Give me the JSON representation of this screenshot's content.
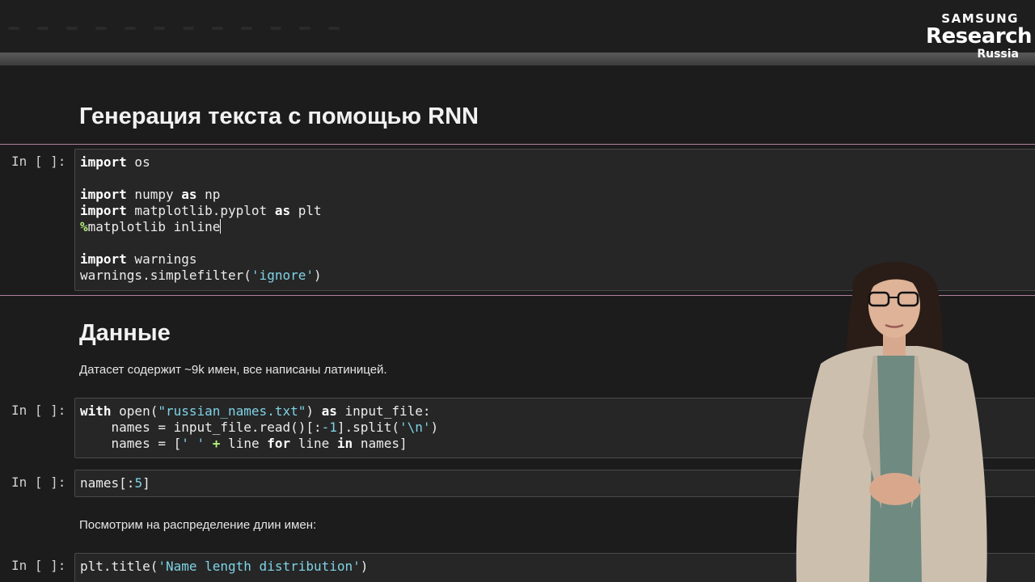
{
  "logo": {
    "line1": "SAMSUNG",
    "line2": "Research",
    "line3": "Russia"
  },
  "notebook": {
    "title": "Генерация текста с помощью RNN",
    "section_data_heading": "Данные",
    "dataset_description": "Датасет содержит ~9k имен, все написаны латиницей.",
    "distribution_text": "Посмотрим на распределение длин имен:",
    "prompt_label": "In [ ]:",
    "cells": {
      "imports": {
        "l1": {
          "kw": "import",
          "rest": " os"
        },
        "l2": {
          "kw": "import",
          "a": " numpy ",
          "kw2": "as",
          "b": " np"
        },
        "l3": {
          "kw": "import",
          "a": " matplotlib.pyplot ",
          "kw2": "as",
          "b": " plt"
        },
        "l4": {
          "op": "%",
          "rest": "matplotlib inline"
        },
        "l5": {
          "kw": "import",
          "rest": " warnings"
        },
        "l6": {
          "a": "warnings.simplefilter(",
          "str": "'ignore'",
          "b": ")"
        }
      },
      "read": {
        "l1": {
          "kw": "with",
          "a": " open(",
          "str": "\"russian_names.txt\"",
          "b": ") ",
          "kw2": "as",
          "c": " input_file:"
        },
        "l2": {
          "a": "    names = input_file.read()[:",
          "num": "-1",
          "b": "].split(",
          "str": "'\\n'",
          "c": ")"
        },
        "l3": {
          "a": "    names = [",
          "str": "' '",
          "b": " ",
          "op": "+",
          "c": " line ",
          "kw": "for",
          "d": " line ",
          "kw2": "in",
          "e": " names]"
        }
      },
      "head": {
        "a": "names[:",
        "num": "5",
        "b": "]"
      },
      "plot": {
        "a": "plt.title(",
        "str": "'Name length distribution'",
        "b": ")"
      }
    }
  },
  "colors": {
    "background": "#1c1c1c",
    "cell_separator": "#b07fa0",
    "string": "#7fd3e6",
    "operator": "#b6f07a"
  }
}
